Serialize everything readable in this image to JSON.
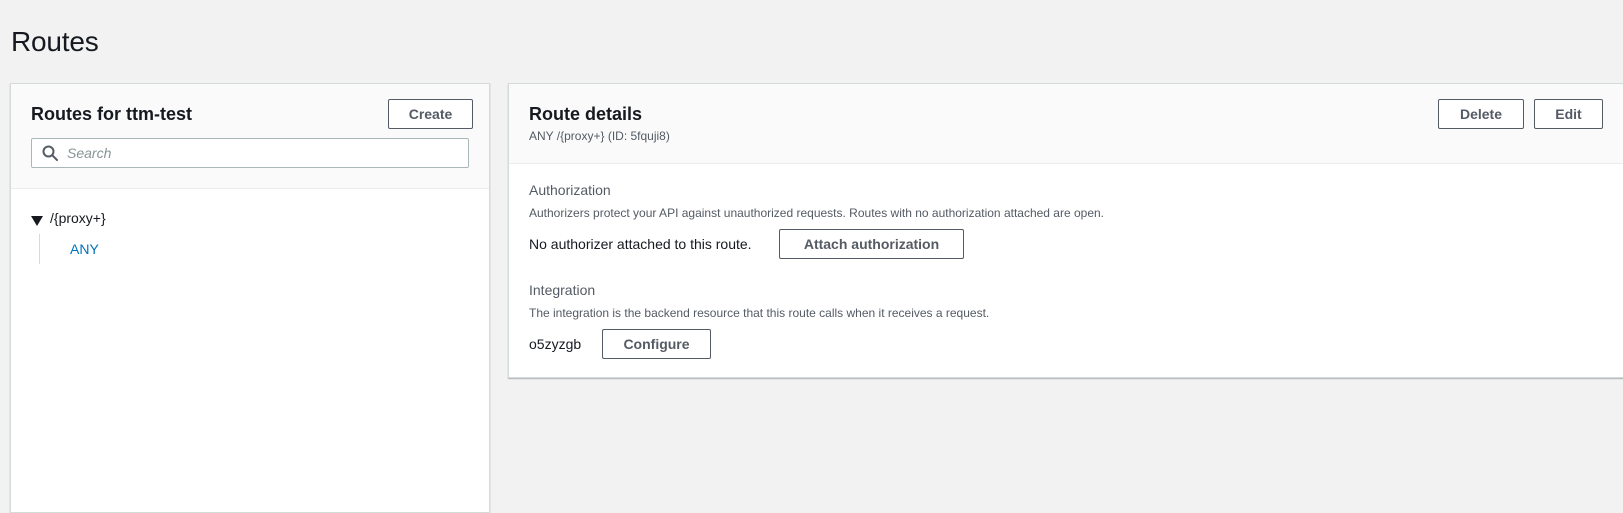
{
  "page": {
    "title": "Routes"
  },
  "routes_panel": {
    "heading": "Routes for ttm-test",
    "create_label": "Create",
    "search_placeholder": "Search",
    "search_value": "",
    "tree": {
      "path": "/{proxy+}",
      "methods": [
        "ANY"
      ]
    }
  },
  "route_details": {
    "heading": "Route details",
    "subtitle": "ANY /{proxy+} (ID: 5fquji8)",
    "delete_label": "Delete",
    "edit_label": "Edit",
    "authorization": {
      "label": "Authorization",
      "description": "Authorizers protect your API against unauthorized requests. Routes with no authorization attached are open.",
      "status": "No authorizer attached to this route.",
      "attach_label": "Attach authorization"
    },
    "integration": {
      "label": "Integration",
      "description": "The integration is the backend resource that this route calls when it receives a request.",
      "value": "o5zyzgb",
      "configure_label": "Configure"
    }
  },
  "colors": {
    "background": "#f2f2f2",
    "link": "#0073bb",
    "button_border": "#545b64",
    "text": "#16191f",
    "muted_text": "#545b64"
  },
  "icons": {
    "search": "search-icon",
    "tree_toggle": "caret-down-icon"
  }
}
